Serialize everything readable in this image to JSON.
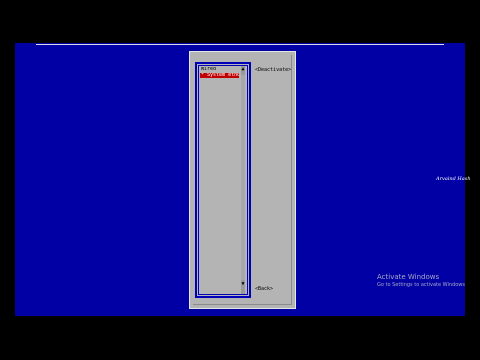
{
  "list": {
    "items": [
      {
        "label": "Wired",
        "selected": false
      },
      {
        "label": "* System eth0",
        "selected": true
      }
    ],
    "scroll_up_glyph": "▲",
    "scroll_down_glyph": "▼"
  },
  "buttons": {
    "deactivate_label": "<Deactivate>",
    "back_label": "<Back>"
  },
  "watermark": {
    "title": "Activate Windows",
    "subtitle": "Go to Settings to activate Windows"
  },
  "signature": "Arvaind Hash",
  "colors": {
    "screen_background": "#0000a4",
    "dialog_background": "#b4b4b4",
    "selection": "#c00000",
    "frame_border": "#0000b8"
  }
}
